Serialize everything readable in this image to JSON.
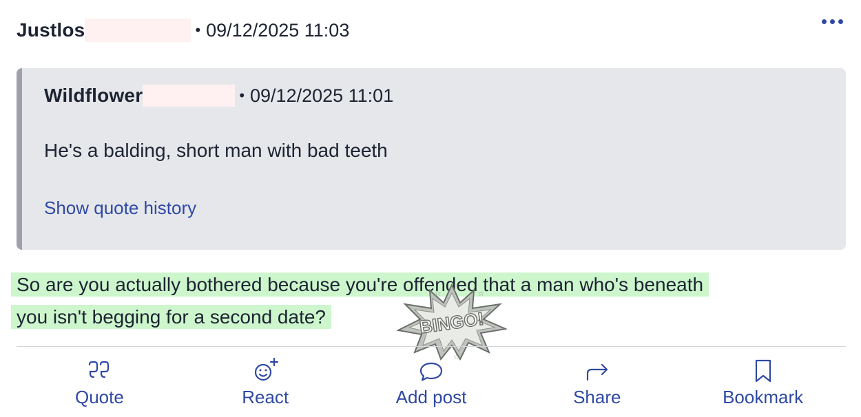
{
  "post": {
    "author": "Justlos",
    "separator": "•",
    "timestamp": "09/12/2025 11:03",
    "more_icon": "ellipsis-icon",
    "quote": {
      "author": "Wildflower",
      "timestamp": "09/12/2025 11:01",
      "text": "He's a balding, short man with bad teeth",
      "history_link": "Show quote history"
    },
    "body_line1": "So are you actually bothered because you're offended that a man who's beneath",
    "body_line2": "you isn't begging for a second date?",
    "sticker_text": "BINGO!",
    "colors": {
      "accent": "#2f49a3",
      "highlight": "#cdf6cd",
      "quote_bg": "#e6e7eb",
      "quote_border": "#9ea1ad",
      "redaction": "#fff1f1"
    }
  },
  "actions": [
    {
      "label": "Quote",
      "icon": "quote-icon"
    },
    {
      "label": "React",
      "icon": "react-icon"
    },
    {
      "label": "Add post",
      "icon": "comment-icon"
    },
    {
      "label": "Share",
      "icon": "share-icon"
    },
    {
      "label": "Bookmark",
      "icon": "bookmark-icon"
    }
  ]
}
